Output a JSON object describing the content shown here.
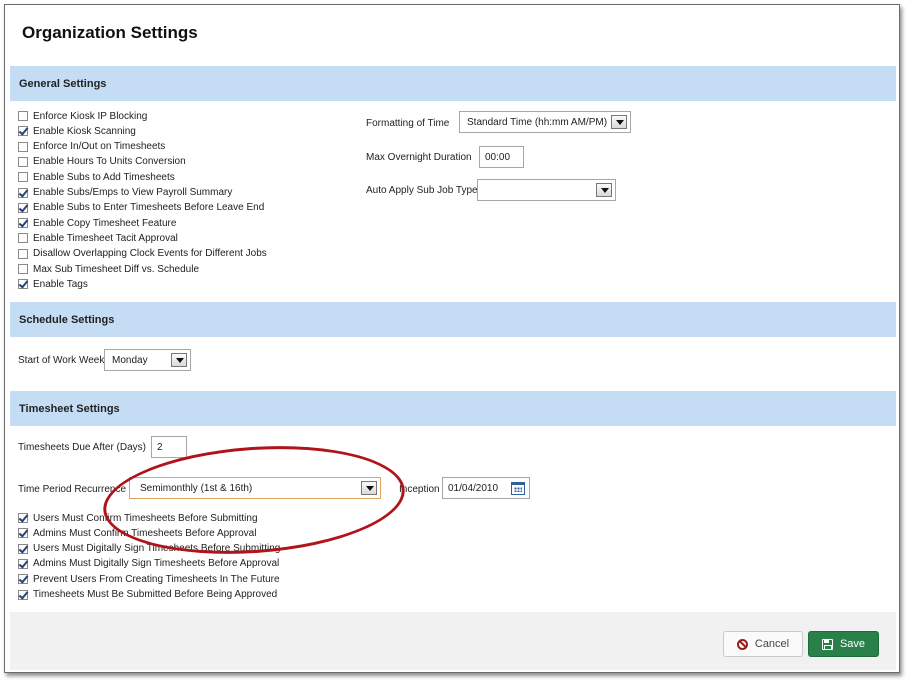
{
  "page_title": "Organization Settings",
  "general": {
    "header": "General Settings",
    "checkboxes": [
      {
        "label": "Enforce Kiosk IP Blocking",
        "checked": false
      },
      {
        "label": "Enable Kiosk Scanning",
        "checked": true
      },
      {
        "label": "Enforce In/Out on Timesheets",
        "checked": false
      },
      {
        "label": "Enable Hours To Units Conversion",
        "checked": false
      },
      {
        "label": "Enable Subs to Add Timesheets",
        "checked": false
      },
      {
        "label": "Enable Subs/Emps to View Payroll Summary",
        "checked": true
      },
      {
        "label": "Enable Subs to Enter Timesheets Before Leave End",
        "checked": true
      },
      {
        "label": "Enable Copy Timesheet Feature",
        "checked": true
      },
      {
        "label": "Enable Timesheet Tacit Approval",
        "checked": false
      },
      {
        "label": "Disallow Overlapping Clock Events for Different Jobs",
        "checked": false
      },
      {
        "label": "Max Sub Timesheet Diff vs. Schedule",
        "checked": false
      },
      {
        "label": "Enable Tags",
        "checked": true
      }
    ],
    "formatting_of_time_label": "Formatting of Time",
    "formatting_of_time_value": "Standard Time (hh:mm AM/PM)",
    "max_overnight_label": "Max Overnight Duration",
    "max_overnight_value": "00:00",
    "auto_apply_label": "Auto Apply Sub Job Type",
    "auto_apply_value": ""
  },
  "schedule": {
    "header": "Schedule Settings",
    "start_week_label": "Start of Work Week",
    "start_week_value": "Monday"
  },
  "timesheet": {
    "header": "Timesheet Settings",
    "due_after_label": "Timesheets Due After (Days)",
    "due_after_value": "2",
    "recurrence_label": "Time Period Recurrence",
    "recurrence_value": "Semimonthly (1st & 16th)",
    "inception_label": "Inception",
    "inception_value": "01/04/2010",
    "checkboxes": [
      {
        "label": "Users Must Confirm Timesheets Before Submitting",
        "checked": true
      },
      {
        "label": "Admins Must Confirm Timesheets Before Approval",
        "checked": true
      },
      {
        "label": "Users Must Digitally Sign Timesheets Before Submitting",
        "checked": true
      },
      {
        "label": "Admins Must Digitally Sign Timesheets Before Approval",
        "checked": true
      },
      {
        "label": "Prevent Users From Creating Timesheets In The Future",
        "checked": true
      },
      {
        "label": "Timesheets Must Be Submitted Before Being Approved",
        "checked": true
      }
    ]
  },
  "footer": {
    "cancel_label": "Cancel",
    "save_label": "Save"
  },
  "colors": {
    "section_header_bg": "#c4dcf4",
    "save_button_bg": "#2a8049",
    "highlight_annotation": "#b0131a"
  },
  "icons": {
    "cancel": "no-entry-icon",
    "save": "floppy-disk-icon",
    "calendar": "calendar-icon",
    "dropdown": "chevron-down-icon"
  }
}
